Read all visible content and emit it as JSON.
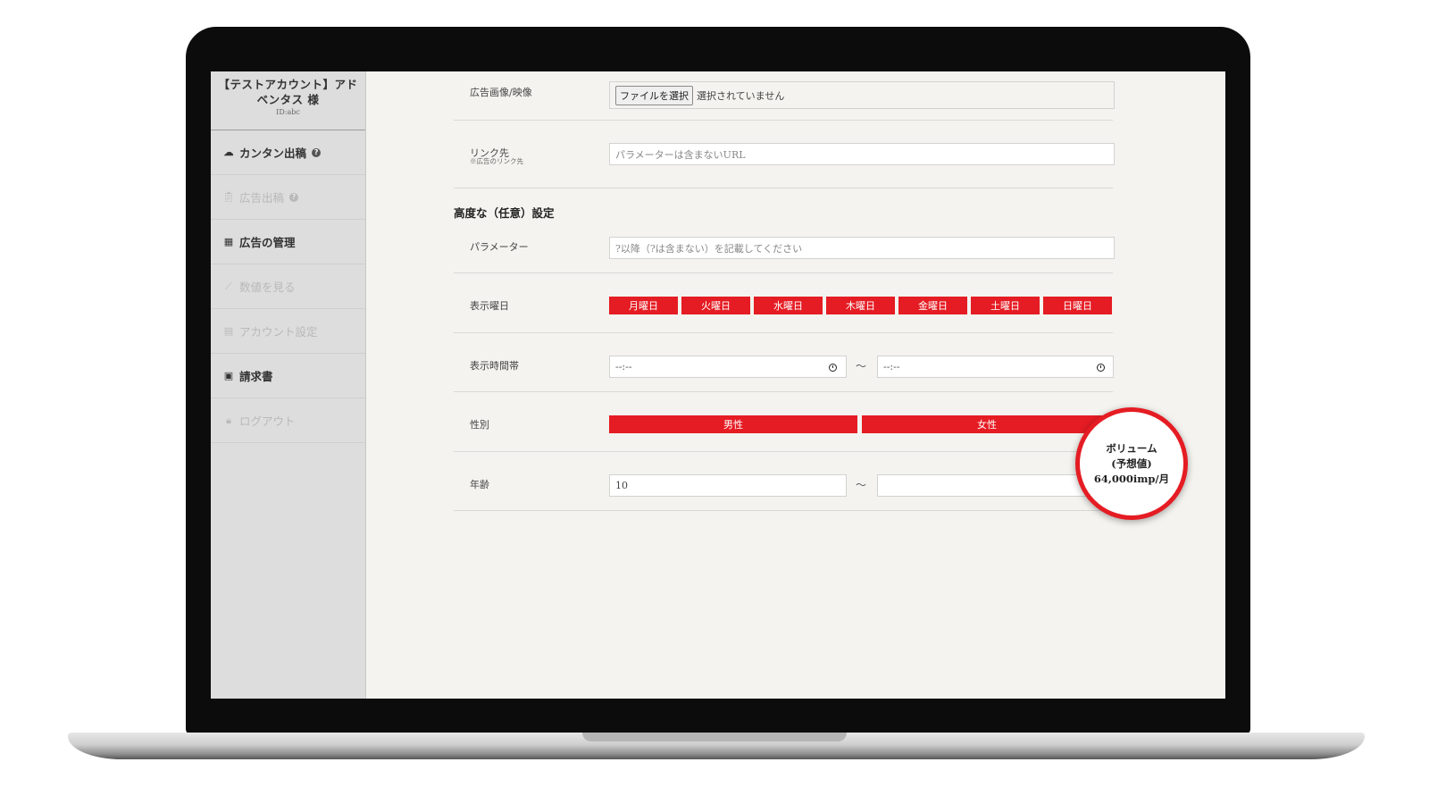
{
  "sidebar": {
    "account_name": "【テストアカウント】アドベンタス 様",
    "account_id": "ID:abc",
    "items": [
      {
        "label": "カンタン出稿",
        "icon": "cloud-upload-icon",
        "enabled": true,
        "help": "?"
      },
      {
        "label": "広告出稿",
        "icon": "clipboard-icon",
        "enabled": false,
        "help": "?"
      },
      {
        "label": "広告の管理",
        "icon": "calendar-icon",
        "enabled": true
      },
      {
        "label": "数値を見る",
        "icon": "chart-icon",
        "enabled": false
      },
      {
        "label": "アカウント設定",
        "icon": "id-card-icon",
        "enabled": false
      },
      {
        "label": "請求書",
        "icon": "inbox-icon",
        "enabled": true
      },
      {
        "label": "ログアウト",
        "icon": "lock-icon",
        "enabled": false
      }
    ]
  },
  "form": {
    "ad_image": {
      "label": "広告画像/映像",
      "button": "ファイルを選択",
      "status": "選択されていません"
    },
    "link": {
      "label": "リンク先",
      "sublabel": "※広告のリンク先",
      "placeholder": "パラメーターは含まないURL"
    },
    "advanced_title": "高度な（任意）設定",
    "params": {
      "label": "パラメーター",
      "placeholder": "?以降（?は含まない）を記載してください"
    },
    "days": {
      "label": "表示曜日",
      "options": [
        "月曜日",
        "火曜日",
        "水曜日",
        "木曜日",
        "金曜日",
        "土曜日",
        "日曜日"
      ]
    },
    "time": {
      "label": "表示時間帯",
      "start": "--:--",
      "end": "--:--",
      "separator": "〜"
    },
    "gender": {
      "label": "性別",
      "options": [
        "男性",
        "女性"
      ]
    },
    "age": {
      "label": "年齢",
      "min": "10",
      "max": "",
      "separator": "〜"
    }
  },
  "volume": {
    "line1": "ボリューム",
    "line2": "(予想値)",
    "line3": "64,000imp/月"
  },
  "colors": {
    "accent": "#e51c23",
    "sidebar": "#dddddd",
    "content_bg": "#f4f3ef"
  }
}
